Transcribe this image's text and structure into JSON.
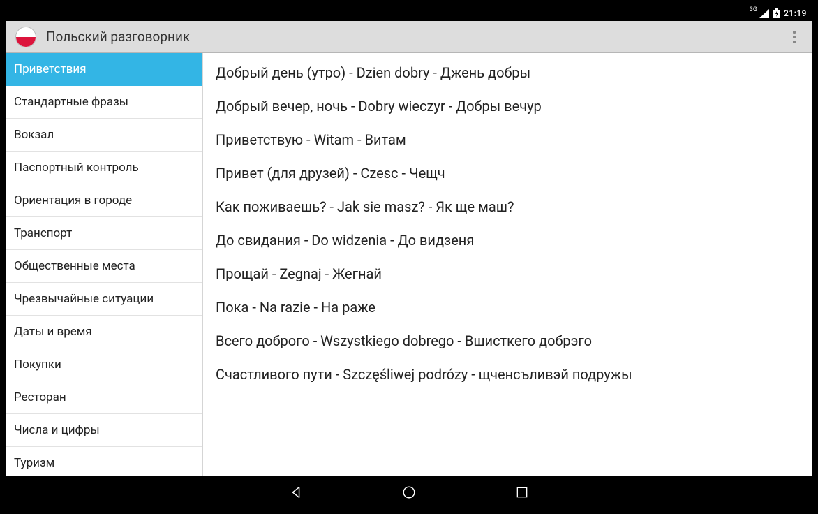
{
  "statusBar": {
    "networkLabel": "3G",
    "time": "21:19"
  },
  "appBar": {
    "title": "Польский разговорник"
  },
  "sidebar": {
    "selectedIndex": 0,
    "items": [
      {
        "label": "Приветствия"
      },
      {
        "label": "Стандартные фразы"
      },
      {
        "label": "Вокзал"
      },
      {
        "label": "Паспортный контроль"
      },
      {
        "label": "Ориентация в городе"
      },
      {
        "label": "Транспорт"
      },
      {
        "label": "Общественные места"
      },
      {
        "label": "Чрезвычайные ситуации"
      },
      {
        "label": "Даты и время"
      },
      {
        "label": "Покупки"
      },
      {
        "label": "Ресторан"
      },
      {
        "label": "Числа и цифры"
      },
      {
        "label": "Туризм"
      }
    ]
  },
  "phrases": [
    {
      "text": "Добрый день (утро) - Dzien dobry - Джень добры"
    },
    {
      "text": "Добрый вечер, ночь - Dobry wieczyr - Добры вечур"
    },
    {
      "text": "Приветствую - Witam - Витам"
    },
    {
      "text": "Привет (для друзей) - Czesc - Чещч"
    },
    {
      "text": "Как поживаешь? - Jak sie masz? - Як ще маш?"
    },
    {
      "text": "До свидания - Do widzenia - До видзеня"
    },
    {
      "text": "Прощай - Zegnaj - Жегнай"
    },
    {
      "text": "Пока - Na razie - На раже"
    },
    {
      "text": "Всего доброго - Wszystkiego dobrego - Вшисткего добрэго"
    },
    {
      "text": "Счастливого пути - Szczęśliwej podrózy - щченсъливэй подружы"
    }
  ]
}
